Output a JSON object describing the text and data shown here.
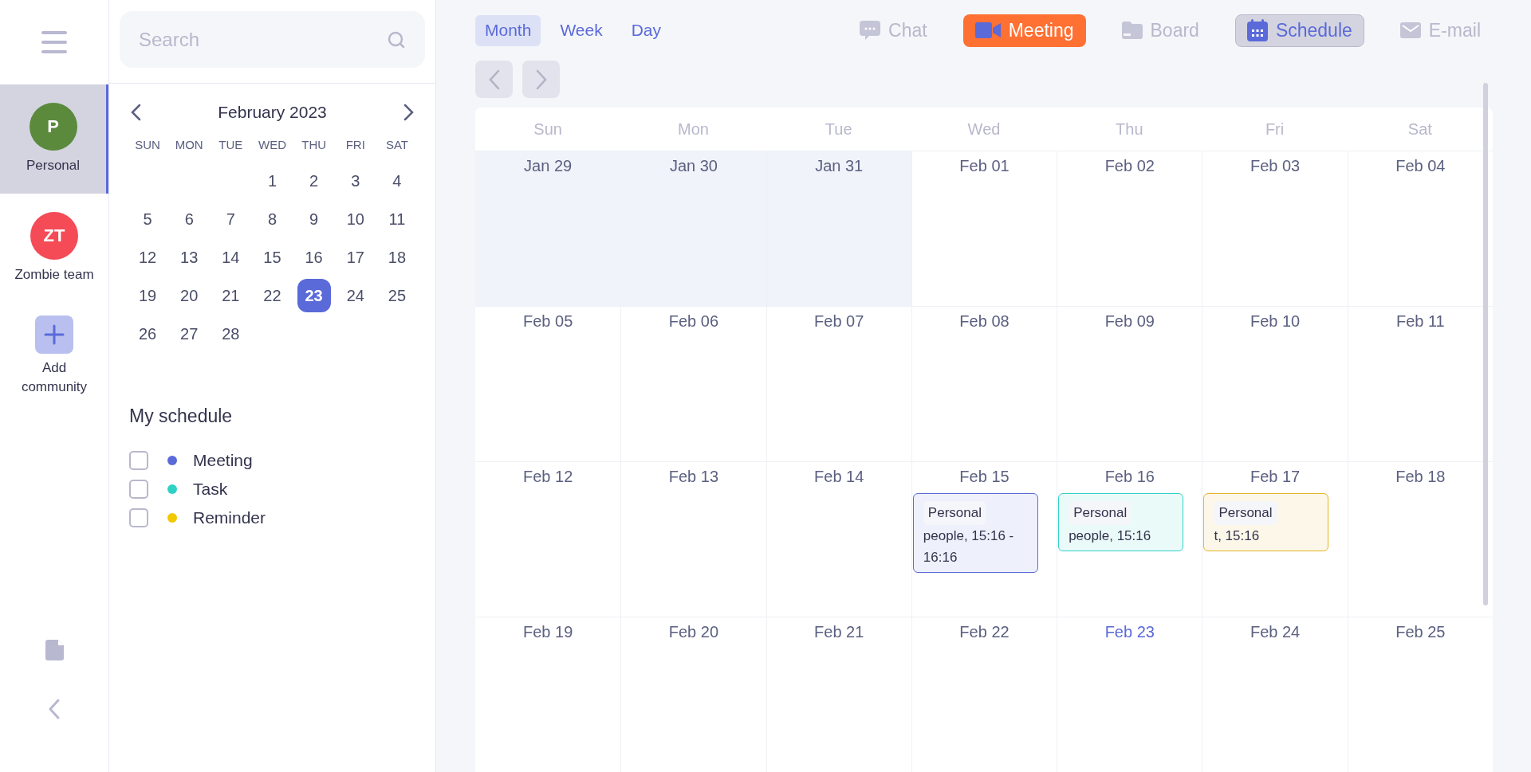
{
  "communities": [
    {
      "label": "Personal",
      "initials": "P",
      "color": "#5b8a3c",
      "selected": true
    },
    {
      "label": "Zombie team",
      "initials": "ZT",
      "color": "#f44b57",
      "selected": false
    }
  ],
  "add_community": {
    "label": "Add community"
  },
  "search": {
    "placeholder": "Search"
  },
  "mini_calendar": {
    "title": "February 2023",
    "weekdays": [
      "SUN",
      "MON",
      "TUE",
      "WED",
      "THU",
      "FRI",
      "SAT"
    ],
    "weeks": [
      [
        {
          "kind": "blank"
        },
        {
          "kind": "blank"
        },
        {
          "kind": "blank"
        },
        {
          "kind": "day",
          "day": "1",
          "selected": false
        },
        {
          "kind": "day",
          "day": "2",
          "selected": false
        },
        {
          "kind": "day",
          "day": "3",
          "selected": false
        },
        {
          "kind": "day",
          "day": "4",
          "selected": false
        }
      ],
      [
        {
          "kind": "day",
          "day": "5",
          "selected": false
        },
        {
          "kind": "day",
          "day": "6",
          "selected": false
        },
        {
          "kind": "day",
          "day": "7",
          "selected": false
        },
        {
          "kind": "day",
          "day": "8",
          "selected": false
        },
        {
          "kind": "day",
          "day": "9",
          "selected": false
        },
        {
          "kind": "day",
          "day": "10",
          "selected": false
        },
        {
          "kind": "day",
          "day": "11",
          "selected": false
        }
      ],
      [
        {
          "kind": "day",
          "day": "12",
          "selected": false
        },
        {
          "kind": "day",
          "day": "13",
          "selected": false
        },
        {
          "kind": "day",
          "day": "14",
          "selected": false
        },
        {
          "kind": "day",
          "day": "15",
          "selected": false
        },
        {
          "kind": "day",
          "day": "16",
          "selected": false
        },
        {
          "kind": "day",
          "day": "17",
          "selected": false
        },
        {
          "kind": "day",
          "day": "18",
          "selected": false
        }
      ],
      [
        {
          "kind": "day",
          "day": "19",
          "selected": false
        },
        {
          "kind": "day",
          "day": "20",
          "selected": false
        },
        {
          "kind": "day",
          "day": "21",
          "selected": false
        },
        {
          "kind": "day",
          "day": "22",
          "selected": false
        },
        {
          "kind": "day",
          "day": "23",
          "selected": true
        },
        {
          "kind": "day",
          "day": "24",
          "selected": false
        },
        {
          "kind": "day",
          "day": "25",
          "selected": false
        }
      ],
      [
        {
          "kind": "day",
          "day": "26",
          "selected": false
        },
        {
          "kind": "day",
          "day": "27",
          "selected": false
        },
        {
          "kind": "day",
          "day": "28",
          "selected": false
        }
      ]
    ]
  },
  "my_schedule": {
    "title": "My schedule",
    "items": [
      {
        "label": "Meeting",
        "color": "#5a6ad9",
        "checked": false
      },
      {
        "label": "Task",
        "color": "#2fd1c5",
        "checked": false
      },
      {
        "label": "Reminder",
        "color": "#f2c800",
        "checked": false
      }
    ]
  },
  "view_tabs": [
    {
      "label": "Month",
      "selected": true
    },
    {
      "label": "Week",
      "selected": false
    },
    {
      "label": "Day",
      "selected": false
    }
  ],
  "app_tabs": [
    {
      "label": "Chat",
      "kind": "chat",
      "selected": false,
      "highlighted": false
    },
    {
      "label": "Meeting",
      "kind": "meeting",
      "selected": false,
      "highlighted": true
    },
    {
      "label": "Board",
      "kind": "board",
      "selected": false,
      "highlighted": false
    },
    {
      "label": "Schedule",
      "kind": "schedule",
      "selected": true,
      "highlighted": false
    },
    {
      "label": "E-mail",
      "kind": "email",
      "selected": false,
      "highlighted": false
    }
  ],
  "calendar": {
    "weekdays": [
      "Sun",
      "Mon",
      "Tue",
      "Wed",
      "Thu",
      "Fri",
      "Sat"
    ],
    "weeks": [
      [
        {
          "date": "Jan 29",
          "outside": true,
          "today": false
        },
        {
          "date": "Jan 30",
          "outside": true,
          "today": false
        },
        {
          "date": "Jan 31",
          "outside": true,
          "today": false
        },
        {
          "date": "Feb 01",
          "outside": false,
          "today": false
        },
        {
          "date": "Feb 02",
          "outside": false,
          "today": false
        },
        {
          "date": "Feb 03",
          "outside": false,
          "today": false
        },
        {
          "date": "Feb 04",
          "outside": false,
          "today": false
        }
      ],
      [
        {
          "date": "Feb 05",
          "outside": false,
          "today": false
        },
        {
          "date": "Feb 06",
          "outside": false,
          "today": false
        },
        {
          "date": "Feb 07",
          "outside": false,
          "today": false
        },
        {
          "date": "Feb 08",
          "outside": false,
          "today": false
        },
        {
          "date": "Feb 09",
          "outside": false,
          "today": false
        },
        {
          "date": "Feb 10",
          "outside": false,
          "today": false
        },
        {
          "date": "Feb 11",
          "outside": false,
          "today": false
        }
      ],
      [
        {
          "date": "Feb 12",
          "outside": false,
          "today": false
        },
        {
          "date": "Feb 13",
          "outside": false,
          "today": false
        },
        {
          "date": "Feb 14",
          "outside": false,
          "today": false
        },
        {
          "date": "Feb 15",
          "outside": false,
          "today": false,
          "events": [
            {
              "tag": "Personal",
              "text": "people, 15:16 - 16:16",
              "color": "#5a6ad9"
            }
          ]
        },
        {
          "date": "Feb 16",
          "outside": false,
          "today": false,
          "events": [
            {
              "tag": "Personal",
              "text": "people, 15:16",
              "color": "#2fd1c5"
            }
          ]
        },
        {
          "date": "Feb 17",
          "outside": false,
          "today": false,
          "events": [
            {
              "tag": "Personal",
              "text": "t, 15:16",
              "color": "#e6b422"
            }
          ]
        },
        {
          "date": "Feb 18",
          "outside": false,
          "today": false
        }
      ],
      [
        {
          "date": "Feb 19",
          "outside": false,
          "today": false
        },
        {
          "date": "Feb 20",
          "outside": false,
          "today": false
        },
        {
          "date": "Feb 21",
          "outside": false,
          "today": false
        },
        {
          "date": "Feb 22",
          "outside": false,
          "today": false
        },
        {
          "date": "Feb 23",
          "outside": false,
          "today": true
        },
        {
          "date": "Feb 24",
          "outside": false,
          "today": false
        },
        {
          "date": "Feb 25",
          "outside": false,
          "today": false
        }
      ]
    ]
  }
}
